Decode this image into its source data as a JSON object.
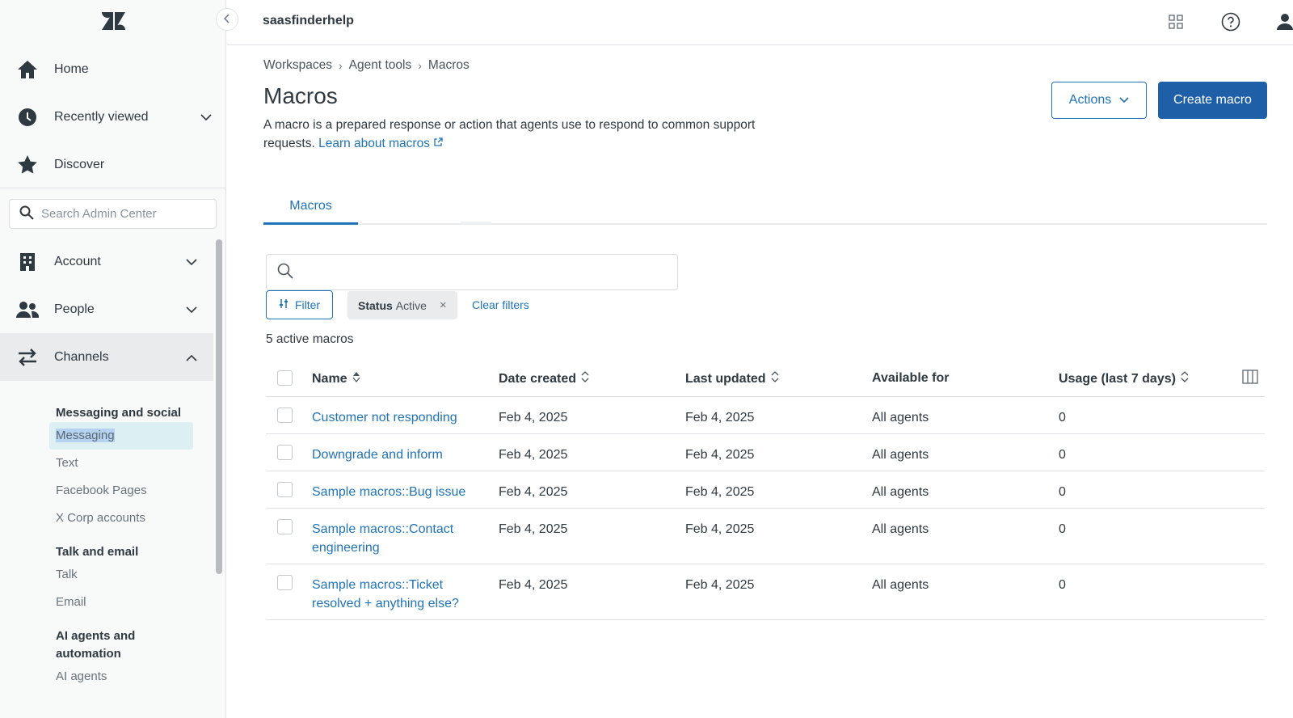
{
  "app": {
    "brand": "saasfinderhelp"
  },
  "sidebar": {
    "top_items": [
      {
        "label": "Home",
        "icon": "home-icon"
      },
      {
        "label": "Recently viewed",
        "icon": "clock-icon"
      },
      {
        "label": "Discover",
        "icon": "star-icon"
      }
    ],
    "search_placeholder": "Search Admin Center",
    "sections": [
      {
        "label": "Account",
        "icon": "building-icon"
      },
      {
        "label": "People",
        "icon": "people-icon"
      },
      {
        "label": "Channels",
        "icon": "arrows-icon"
      }
    ],
    "sub": {
      "group1_heading": "Messaging and social",
      "group1_items": [
        "Messaging",
        "Text",
        "Facebook Pages",
        "X Corp accounts"
      ],
      "group2_heading": "Talk and email",
      "group2_items": [
        "Talk",
        "Email"
      ],
      "group3_heading": "AI agents and automation",
      "group3_items": [
        "AI agents"
      ]
    }
  },
  "breadcrumb": [
    "Workspaces",
    "Agent tools",
    "Macros"
  ],
  "page": {
    "title": "Macros",
    "description": "A macro is a prepared response or action that agents use to respond to common support requests.",
    "learn_link": "Learn about macros",
    "actions_label": "Actions",
    "create_label": "Create macro"
  },
  "tabs": [
    "Macros"
  ],
  "filters": {
    "filter_label": "Filter",
    "chip_key": "Status",
    "chip_value": "Active",
    "clear_label": "Clear filters",
    "count_text": "5 active macros"
  },
  "table": {
    "headers": [
      "Name",
      "Date created",
      "Last updated",
      "Available for",
      "Usage (last 7 days)"
    ],
    "rows": [
      {
        "name": "Customer not responding",
        "created": "Feb 4, 2025",
        "updated": "Feb 4, 2025",
        "available": "All agents",
        "usage": "0"
      },
      {
        "name": "Downgrade and inform",
        "created": "Feb 4, 2025",
        "updated": "Feb 4, 2025",
        "available": "All agents",
        "usage": "0"
      },
      {
        "name": "Sample macros::Bug issue",
        "created": "Feb 4, 2025",
        "updated": "Feb 4, 2025",
        "available": "All agents",
        "usage": "0"
      },
      {
        "name": "Sample macros::Contact engineering",
        "created": "Feb 4, 2025",
        "updated": "Feb 4, 2025",
        "available": "All agents",
        "usage": "0"
      },
      {
        "name": "Sample macros::Ticket resolved + anything else?",
        "created": "Feb 4, 2025",
        "updated": "Feb 4, 2025",
        "available": "All agents",
        "usage": "0"
      }
    ]
  },
  "colors": {
    "accent": "#1f73b7",
    "primary_button": "#1f5fa8",
    "sidebar_bg": "#f8f9f9"
  }
}
